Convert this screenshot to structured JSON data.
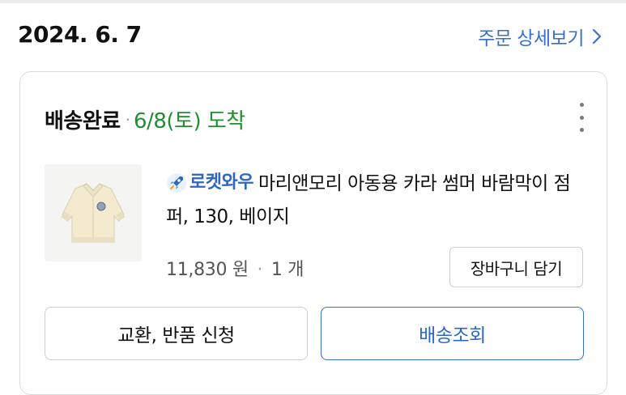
{
  "header": {
    "order_date": "2024. 6. 7",
    "detail_link": "주문 상세보기"
  },
  "shipment": {
    "status": "배송완료",
    "arrival": "6/8(토) 도착"
  },
  "product": {
    "badge_label": "로켓와우",
    "title": "마리앤모리 아동용 카라 썸머 바람막이 점퍼, 130, 베이지",
    "price": "11,830 원",
    "quantity": "1 개",
    "cart_button": "장바구니 담기"
  },
  "actions": {
    "exchange_return": "교환, 반품 신청",
    "track_delivery": "배송조회"
  },
  "colors": {
    "link_blue": "#3a6fc9",
    "arrival_green": "#1f8f2f"
  },
  "icons": {
    "detail_chevron": "chevron-right-icon",
    "more": "more-vertical-icon",
    "badge": "rocket-icon"
  }
}
